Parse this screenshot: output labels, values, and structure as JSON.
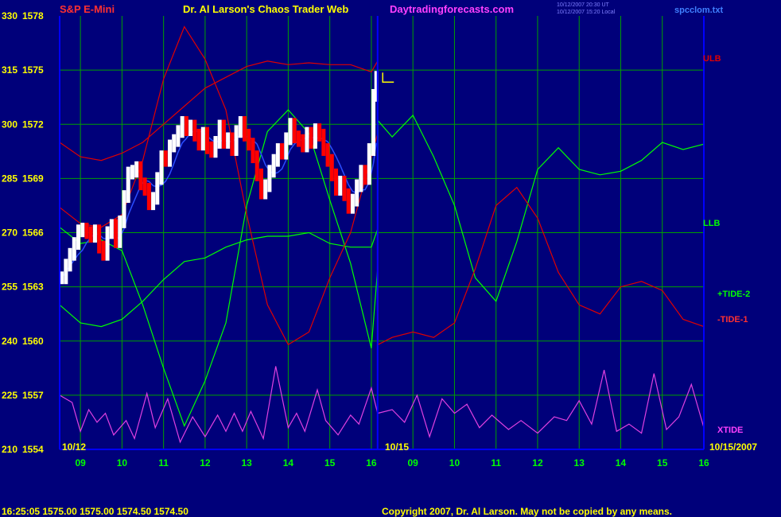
{
  "header": {
    "instrument": "S&P E-Mini",
    "title": "Dr. Al Larson's Chaos Trader Web",
    "site": "Daytradingforecasts.com",
    "stamp_line1": "10/12/2007 20:30 UT",
    "stamp_line2": "10/12/2007 15:20 Local",
    "file": "spcclom.txt"
  },
  "footer": {
    "quote": "16:25:05  1575.00  1575.00  1574.50  1574.50",
    "copyright": "Copyright 2007, Dr. Al Larson. May not be copied by any means."
  },
  "colors": {
    "background": "#00007a",
    "grid": "#00a000",
    "axis": "#0000ff",
    "price_up": "#ffffff",
    "price_down": "#ff0000",
    "ma": "#2a4dff",
    "ulb": "#e00000",
    "llb": "#00ff00",
    "tide_plus": "#00ff00",
    "tide_minus": "#e00000",
    "xtide": "#e040e0",
    "axis_text": "#ffff00",
    "hour_text": "#00ff00"
  },
  "chart_data": {
    "type": "line",
    "title": "Dr. Al Larson's Chaos Trader Web",
    "ylim": [
      1554,
      1578
    ],
    "left_scale_ticks": [
      "330",
      "315",
      "300",
      "285",
      "270",
      "255",
      "240",
      "225",
      "210"
    ],
    "price_ticks": [
      "1578",
      "1575",
      "1572",
      "1569",
      "1566",
      "1563",
      "1560",
      "1557",
      "1554"
    ],
    "x_hour_labels_1": [
      "09",
      "10",
      "11",
      "12",
      "13",
      "14",
      "15",
      "16"
    ],
    "x_hour_labels_2": [
      "09",
      "10",
      "11",
      "12",
      "13",
      "14",
      "15",
      "16"
    ],
    "date_labels": [
      "10/12",
      "10/15",
      "10/15/2007"
    ],
    "x_range": [
      8.5,
      24.0
    ],
    "today_end": 16.15,
    "right_labels": [
      "ULB",
      "LLB",
      "+TIDE-2",
      "-TIDE-1",
      "XTIDE"
    ],
    "series": [
      {
        "name": "Price",
        "style": "bars",
        "points": [
          [
            8.55,
            1563.5
          ],
          [
            8.65,
            1564.2
          ],
          [
            8.75,
            1564.8
          ],
          [
            8.85,
            1565.4
          ],
          [
            8.95,
            1566.1
          ],
          [
            9.05,
            1566.2
          ],
          [
            9.15,
            1566.0
          ],
          [
            9.25,
            1565.8
          ],
          [
            9.35,
            1566.1
          ],
          [
            9.45,
            1565.2
          ],
          [
            9.55,
            1564.8
          ],
          [
            9.65,
            1566.0
          ],
          [
            9.75,
            1566.4
          ],
          [
            9.85,
            1565.5
          ],
          [
            9.95,
            1566.6
          ],
          [
            10.05,
            1568.0
          ],
          [
            10.15,
            1569.3
          ],
          [
            10.25,
            1569.4
          ],
          [
            10.35,
            1569.6
          ],
          [
            10.45,
            1568.7
          ],
          [
            10.55,
            1568.4
          ],
          [
            10.65,
            1567.6
          ],
          [
            10.75,
            1567.9
          ],
          [
            10.85,
            1569.0
          ],
          [
            10.95,
            1570.2
          ],
          [
            11.05,
            1570.0
          ],
          [
            11.15,
            1570.8
          ],
          [
            11.25,
            1571.1
          ],
          [
            11.35,
            1571.6
          ],
          [
            11.45,
            1572.1
          ],
          [
            11.55,
            1571.7
          ],
          [
            11.65,
            1571.9
          ],
          [
            11.75,
            1571.4
          ],
          [
            11.85,
            1570.9
          ],
          [
            11.95,
            1571.5
          ],
          [
            12.05,
            1570.7
          ],
          [
            12.15,
            1570.5
          ],
          [
            12.25,
            1571.0
          ],
          [
            12.35,
            1571.9
          ],
          [
            12.45,
            1571.0
          ],
          [
            12.55,
            1571.2
          ],
          [
            12.65,
            1570.6
          ],
          [
            12.75,
            1571.6
          ],
          [
            12.85,
            1572.1
          ],
          [
            12.95,
            1571.4
          ],
          [
            13.05,
            1570.9
          ],
          [
            13.15,
            1570.2
          ],
          [
            13.25,
            1569.2
          ],
          [
            13.35,
            1568.2
          ],
          [
            13.45,
            1568.6
          ],
          [
            13.55,
            1569.4
          ],
          [
            13.65,
            1570.0
          ],
          [
            13.75,
            1570.6
          ],
          [
            13.85,
            1570.4
          ],
          [
            13.95,
            1571.2
          ],
          [
            14.05,
            1572.0
          ],
          [
            14.15,
            1571.3
          ],
          [
            14.25,
            1571.1
          ],
          [
            14.35,
            1570.8
          ],
          [
            14.45,
            1571.5
          ],
          [
            14.55,
            1571.0
          ],
          [
            14.65,
            1571.7
          ],
          [
            14.75,
            1571.4
          ],
          [
            14.85,
            1570.6
          ],
          [
            14.95,
            1570.0
          ],
          [
            15.05,
            1569.2
          ],
          [
            15.15,
            1568.4
          ],
          [
            15.25,
            1568.8
          ],
          [
            15.35,
            1568.1
          ],
          [
            15.45,
            1567.4
          ],
          [
            15.55,
            1567.8
          ],
          [
            15.65,
            1568.6
          ],
          [
            15.75,
            1569.4
          ],
          [
            15.85,
            1569.0
          ],
          [
            15.95,
            1570.6
          ],
          [
            16.05,
            1573.6
          ],
          [
            16.12,
            1574.6
          ]
        ]
      },
      {
        "name": "ULB",
        "points": [
          [
            8.5,
            1571.0
          ],
          [
            9.0,
            1570.2
          ],
          [
            9.5,
            1570.0
          ],
          [
            10.0,
            1570.4
          ],
          [
            10.5,
            1571.0
          ],
          [
            11.0,
            1572.0
          ],
          [
            11.5,
            1573.0
          ],
          [
            12.0,
            1574.0
          ],
          [
            12.5,
            1574.6
          ],
          [
            13.0,
            1575.2
          ],
          [
            13.5,
            1575.5
          ],
          [
            14.0,
            1575.3
          ],
          [
            14.5,
            1575.4
          ],
          [
            15.0,
            1575.3
          ],
          [
            15.5,
            1575.3
          ],
          [
            16.0,
            1574.9
          ],
          [
            16.15,
            1575.5
          ]
        ]
      },
      {
        "name": "LLB",
        "points": [
          [
            8.5,
            1562.0
          ],
          [
            9.0,
            1561.0
          ],
          [
            9.5,
            1560.8
          ],
          [
            10.0,
            1561.2
          ],
          [
            10.5,
            1562.2
          ],
          [
            11.0,
            1563.4
          ],
          [
            11.5,
            1564.4
          ],
          [
            12.0,
            1564.6
          ],
          [
            12.5,
            1565.2
          ],
          [
            13.0,
            1565.6
          ],
          [
            13.5,
            1565.8
          ],
          [
            14.0,
            1565.8
          ],
          [
            14.5,
            1566.0
          ],
          [
            15.0,
            1565.4
          ],
          [
            15.5,
            1565.2
          ],
          [
            16.0,
            1565.2
          ],
          [
            16.15,
            1566.2
          ]
        ]
      },
      {
        "name": "+TIDE-2",
        "points": [
          [
            8.5,
            1566.3
          ],
          [
            9.0,
            1565.4
          ],
          [
            9.5,
            1565.6
          ],
          [
            10.0,
            1565.0
          ],
          [
            10.5,
            1562.0
          ],
          [
            11.0,
            1558.5
          ],
          [
            11.5,
            1555.3
          ],
          [
            12.0,
            1557.8
          ],
          [
            12.5,
            1561.0
          ],
          [
            13.0,
            1567.5
          ],
          [
            13.5,
            1571.6
          ],
          [
            14.0,
            1572.8
          ],
          [
            14.5,
            1571.5
          ],
          [
            15.0,
            1567.8
          ],
          [
            15.5,
            1564.3
          ],
          [
            16.0,
            1559.6
          ],
          [
            16.15,
            1564.0
          ],
          [
            16.16,
            1572.2
          ],
          [
            16.5,
            1571.3
          ],
          [
            17.0,
            1572.5
          ],
          [
            17.5,
            1570.2
          ],
          [
            18.0,
            1567.5
          ],
          [
            18.5,
            1563.5
          ],
          [
            19.0,
            1562.2
          ],
          [
            19.5,
            1565.5
          ],
          [
            20.0,
            1569.5
          ],
          [
            20.5,
            1570.7
          ],
          [
            21.0,
            1569.5
          ],
          [
            21.5,
            1569.2
          ],
          [
            22.0,
            1569.4
          ],
          [
            22.5,
            1570.0
          ],
          [
            23.0,
            1571.0
          ],
          [
            23.5,
            1570.6
          ],
          [
            24.0,
            1570.9
          ]
        ]
      },
      {
        "name": "-TIDE-1",
        "points": [
          [
            8.5,
            1567.4
          ],
          [
            9.0,
            1566.5
          ],
          [
            9.5,
            1566.3
          ],
          [
            10.0,
            1567.0
          ],
          [
            10.5,
            1570.0
          ],
          [
            11.0,
            1574.5
          ],
          [
            11.5,
            1577.4
          ],
          [
            12.0,
            1575.6
          ],
          [
            12.5,
            1572.8
          ],
          [
            13.0,
            1567.0
          ],
          [
            13.5,
            1562.0
          ],
          [
            14.0,
            1559.8
          ],
          [
            14.5,
            1560.5
          ],
          [
            15.0,
            1563.5
          ],
          [
            15.5,
            1566.0
          ],
          [
            16.0,
            1570.2
          ],
          [
            16.15,
            1571.5
          ],
          [
            16.16,
            1559.8
          ],
          [
            16.5,
            1560.2
          ],
          [
            17.0,
            1560.5
          ],
          [
            17.5,
            1560.2
          ],
          [
            18.0,
            1561.0
          ],
          [
            18.5,
            1564.0
          ],
          [
            19.0,
            1567.5
          ],
          [
            19.5,
            1568.5
          ],
          [
            20.0,
            1566.8
          ],
          [
            20.5,
            1563.8
          ],
          [
            21.0,
            1562.0
          ],
          [
            21.5,
            1561.5
          ],
          [
            22.0,
            1563.0
          ],
          [
            22.5,
            1563.3
          ],
          [
            23.0,
            1562.8
          ],
          [
            23.5,
            1561.2
          ],
          [
            24.0,
            1560.8
          ]
        ]
      },
      {
        "name": "XTIDE",
        "points": [
          [
            8.5,
            1557.0
          ],
          [
            8.8,
            1556.6
          ],
          [
            9.0,
            1555.0
          ],
          [
            9.2,
            1556.2
          ],
          [
            9.4,
            1555.5
          ],
          [
            9.6,
            1556.0
          ],
          [
            9.8,
            1554.8
          ],
          [
            10.1,
            1555.6
          ],
          [
            10.3,
            1554.6
          ],
          [
            10.6,
            1557.1
          ],
          [
            10.8,
            1555.2
          ],
          [
            11.1,
            1556.8
          ],
          [
            11.4,
            1554.4
          ],
          [
            11.7,
            1555.8
          ],
          [
            12.0,
            1554.7
          ],
          [
            12.3,
            1555.9
          ],
          [
            12.5,
            1555.0
          ],
          [
            12.7,
            1556.0
          ],
          [
            12.9,
            1555.0
          ],
          [
            13.1,
            1556.1
          ],
          [
            13.4,
            1554.6
          ],
          [
            13.7,
            1558.6
          ],
          [
            14.0,
            1555.2
          ],
          [
            14.2,
            1556.0
          ],
          [
            14.4,
            1555.0
          ],
          [
            14.7,
            1557.3
          ],
          [
            14.9,
            1555.6
          ],
          [
            15.2,
            1554.8
          ],
          [
            15.5,
            1555.9
          ],
          [
            15.7,
            1555.4
          ],
          [
            16.0,
            1557.4
          ],
          [
            16.15,
            1556.0
          ],
          [
            16.5,
            1556.2
          ],
          [
            16.8,
            1555.5
          ],
          [
            17.1,
            1557.0
          ],
          [
            17.4,
            1554.7
          ],
          [
            17.7,
            1556.8
          ],
          [
            18.0,
            1556.0
          ],
          [
            18.3,
            1556.5
          ],
          [
            18.6,
            1555.2
          ],
          [
            18.9,
            1555.9
          ],
          [
            19.3,
            1555.1
          ],
          [
            19.6,
            1555.6
          ],
          [
            20.0,
            1554.9
          ],
          [
            20.4,
            1555.8
          ],
          [
            20.7,
            1555.6
          ],
          [
            21.0,
            1556.7
          ],
          [
            21.3,
            1555.4
          ],
          [
            21.6,
            1558.4
          ],
          [
            21.9,
            1555.0
          ],
          [
            22.2,
            1555.4
          ],
          [
            22.5,
            1554.9
          ],
          [
            22.8,
            1558.2
          ],
          [
            23.1,
            1555.1
          ],
          [
            23.4,
            1555.8
          ],
          [
            23.7,
            1557.6
          ],
          [
            24.0,
            1555.2
          ]
        ]
      }
    ]
  }
}
